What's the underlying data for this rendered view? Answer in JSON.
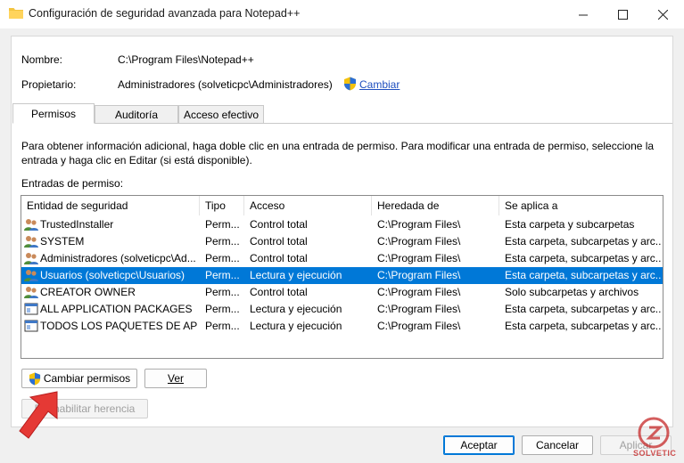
{
  "window": {
    "title": "Configuración de seguridad avanzada para Notepad++"
  },
  "info": {
    "name_label": "Nombre:",
    "name_value": "C:\\Program Files\\Notepad++",
    "owner_label": "Propietario:",
    "owner_value": "Administradores (solveticpc\\Administradores)",
    "change_link": "Cambiar"
  },
  "tabs": [
    {
      "label": "Permisos",
      "active": true
    },
    {
      "label": "Auditoría",
      "active": false
    },
    {
      "label": "Acceso efectivo",
      "active": false
    }
  ],
  "description": "Para obtener información adicional, haga doble clic en una entrada de permiso. Para modificar una entrada de permiso, seleccione la entrada y haga clic en Editar (si está disponible).",
  "entries_label": "Entradas de permiso:",
  "grid": {
    "columns": [
      "Entidad de seguridad",
      "Tipo",
      "Acceso",
      "Heredada de",
      "Se aplica a"
    ],
    "rows": [
      {
        "principal": "TrustedInstaller",
        "type": "Perm...",
        "access": "Control total",
        "inherited": "C:\\Program Files\\",
        "applies": "Esta carpeta y subcarpetas",
        "icon": "users-icon",
        "selected": false
      },
      {
        "principal": "SYSTEM",
        "type": "Perm...",
        "access": "Control total",
        "inherited": "C:\\Program Files\\",
        "applies": "Esta carpeta, subcarpetas y arc...",
        "icon": "users-icon",
        "selected": false
      },
      {
        "principal": "Administradores (solveticpc\\Ad...",
        "type": "Perm...",
        "access": "Control total",
        "inherited": "C:\\Program Files\\",
        "applies": "Esta carpeta, subcarpetas y arc...",
        "icon": "users-icon",
        "selected": false
      },
      {
        "principal": "Usuarios (solveticpc\\Usuarios)",
        "type": "Perm...",
        "access": "Lectura y ejecución",
        "inherited": "C:\\Program Files\\",
        "applies": "Esta carpeta, subcarpetas y arc...",
        "icon": "users-icon",
        "selected": true
      },
      {
        "principal": "CREATOR OWNER",
        "type": "Perm...",
        "access": "Control total",
        "inherited": "C:\\Program Files\\",
        "applies": "Solo subcarpetas y archivos",
        "icon": "users-icon",
        "selected": false
      },
      {
        "principal": "ALL APPLICATION PACKAGES",
        "type": "Perm...",
        "access": "Lectura y ejecución",
        "inherited": "C:\\Program Files\\",
        "applies": "Esta carpeta, subcarpetas y arc...",
        "icon": "package-icon",
        "selected": false
      },
      {
        "principal": "TODOS LOS PAQUETES DE APLI...",
        "type": "Perm...",
        "access": "Lectura y ejecución",
        "inherited": "C:\\Program Files\\",
        "applies": "Esta carpeta, subcarpetas y arc...",
        "icon": "package-icon",
        "selected": false
      }
    ]
  },
  "buttons": {
    "change_permissions": "Cambiar permisos",
    "view": "Ver",
    "disable_inheritance": "Deshabilitar herencia",
    "accept": "Aceptar",
    "cancel": "Cancelar",
    "apply": "Aplicar"
  },
  "watermark": "SOLVETIC",
  "colors": {
    "selection": "#0078d7",
    "link": "#1f4fbf",
    "arrow": "#e53935"
  }
}
